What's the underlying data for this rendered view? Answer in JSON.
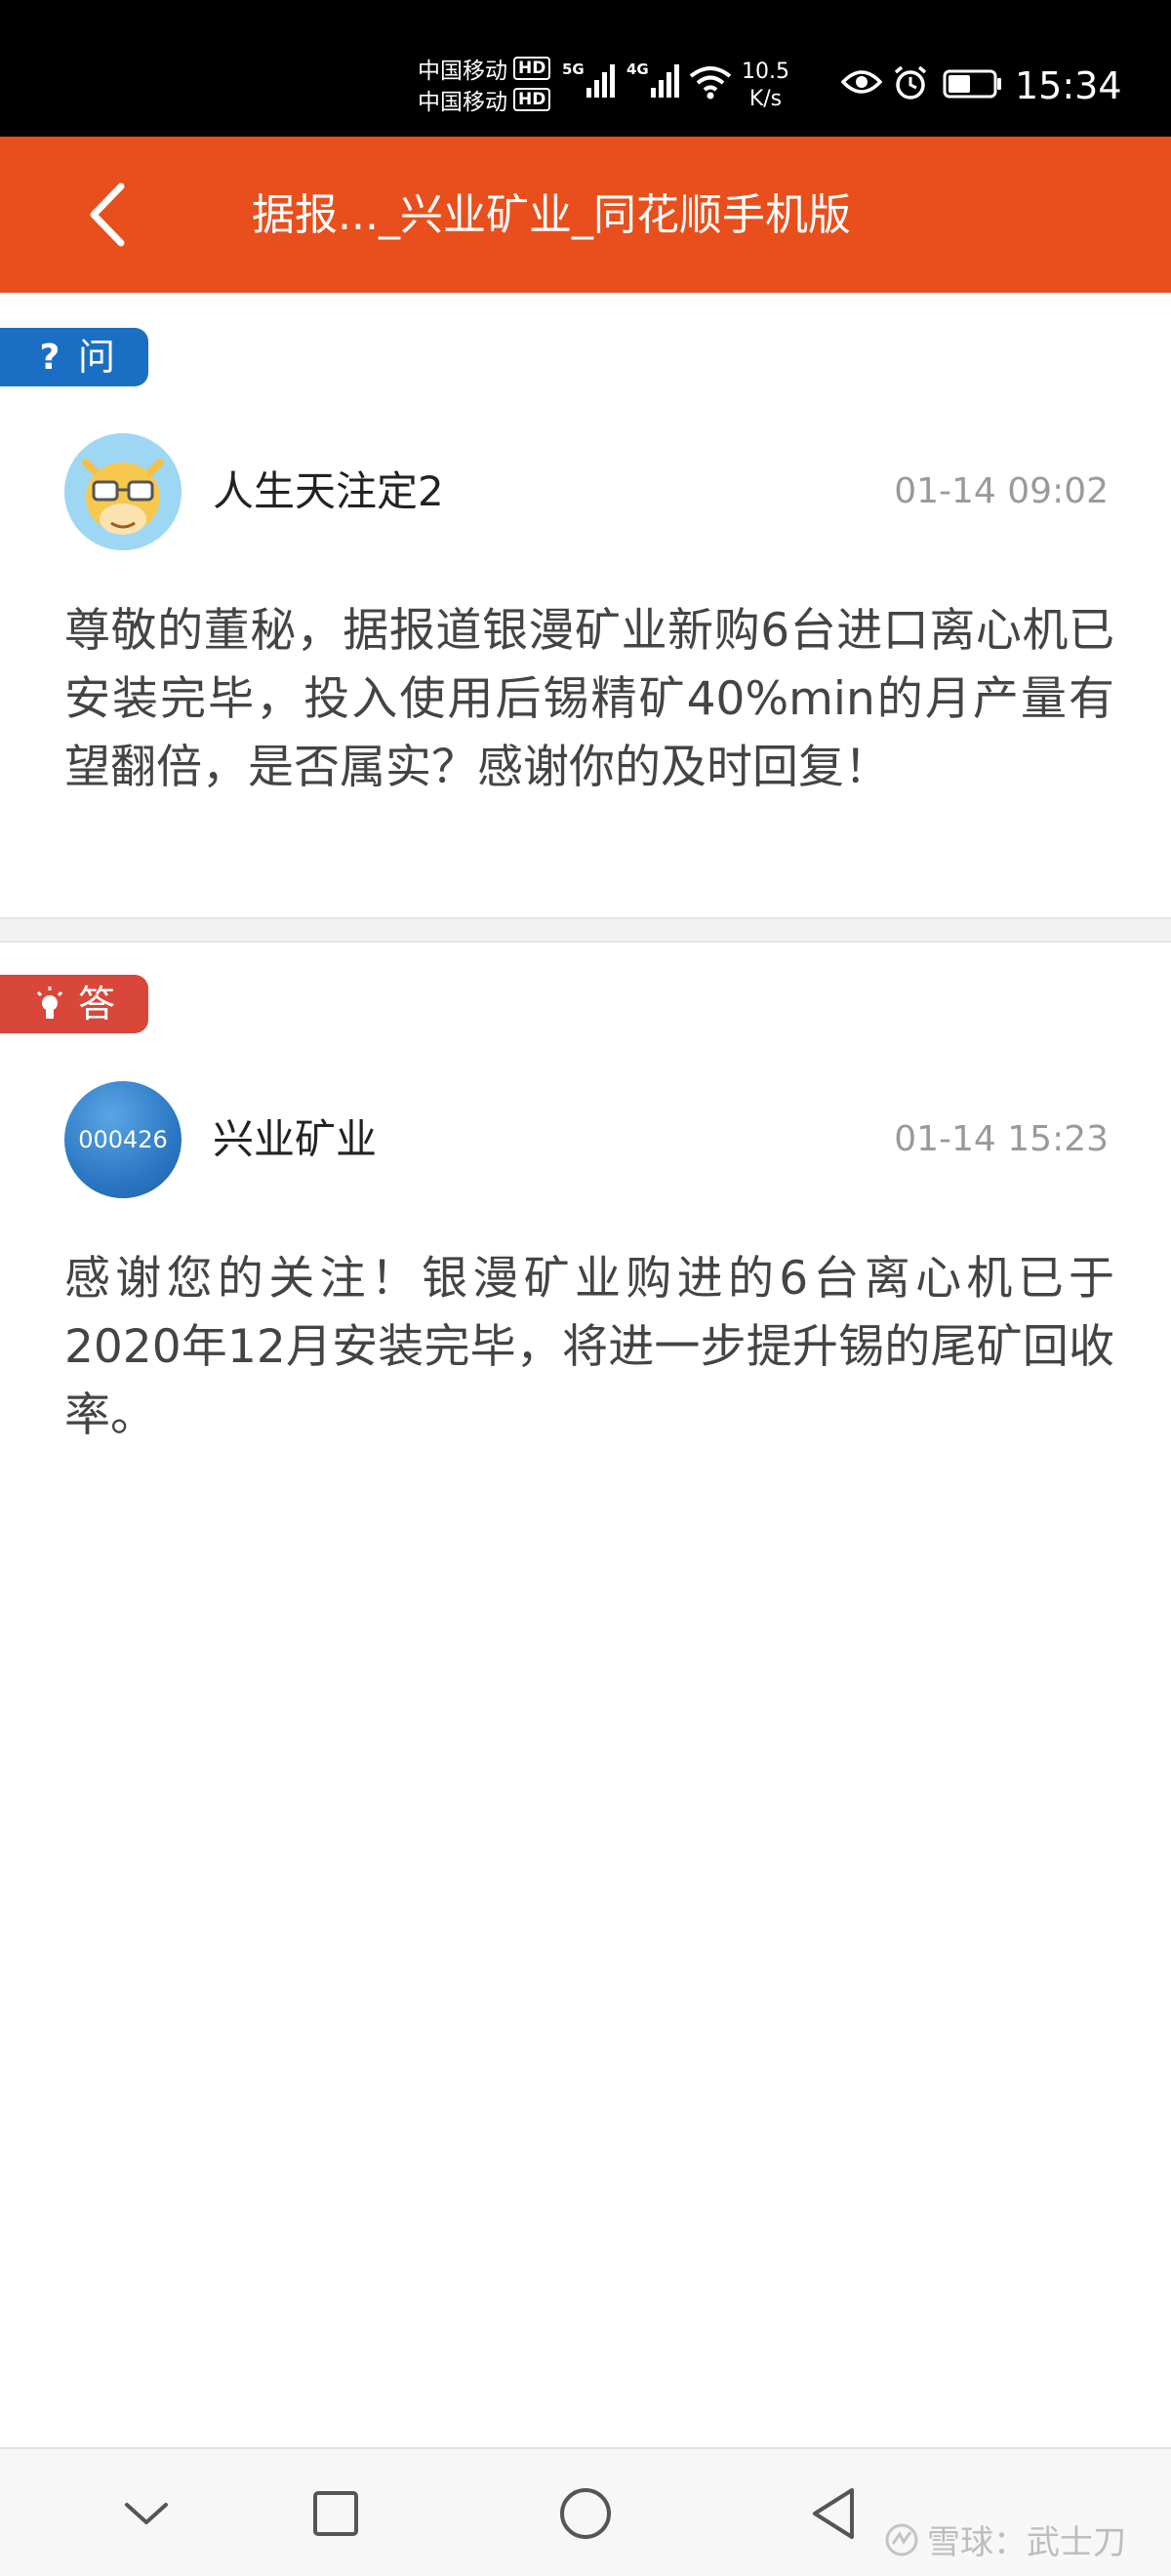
{
  "status_bar": {
    "carrier_1": "中国移动",
    "carrier_2": "中国移动",
    "hd": "HD",
    "signal_1_label": "5G",
    "signal_2_label": "4G",
    "net_speed_value": "10.5",
    "net_speed_unit": "K/s",
    "time": "15:34",
    "icons": [
      "signal-icon",
      "wifi-icon",
      "eye-icon",
      "alarm-icon",
      "battery-icon"
    ]
  },
  "app_bar": {
    "title": "据报..._兴业矿业_同花顺手机版",
    "background": "#e84f1c"
  },
  "question": {
    "tag_icon": "?",
    "tag_label": "问",
    "tag_color": "#1a6fc4",
    "user": "人生天注定2",
    "time": "01-14 09:02",
    "text": "尊敬的董秘，据报道银漫矿业新购6台进口离心机已安装完毕，投入使用后锡精矿40%min的月产量有望翻倍，是否属实？感谢你的及时回复！"
  },
  "answer": {
    "tag_label": "答",
    "tag_color": "#d9473a",
    "avatar_text": "000426",
    "user": "兴业矿业",
    "time": "01-14 15:23",
    "text": "感谢您的关注！银漫矿业购进的6台离心机已于2020年12月安装完毕，将进一步提升锡的尾矿回收率。"
  },
  "nav_bar": {
    "icons": [
      "chevron-down-icon",
      "square-icon",
      "circle-icon",
      "triangle-back-icon"
    ]
  },
  "watermark": {
    "text": "雪球：武士刀"
  }
}
